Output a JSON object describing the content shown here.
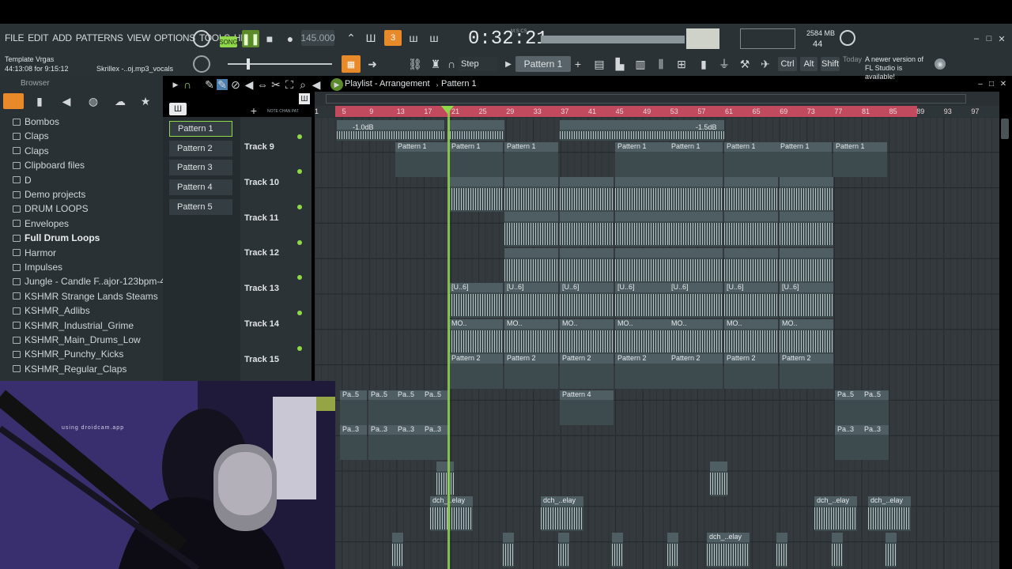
{
  "menu": [
    "FILE",
    "EDIT",
    "ADD",
    "PATTERNS",
    "VIEW",
    "OPTIONS",
    "TOOLS",
    "HELP"
  ],
  "transport": {
    "mode": "SONG",
    "tempo": "145.000",
    "time": "0:32:21",
    "time_unit": "M:S:CS",
    "memory": "2584 MB",
    "cpu": "44"
  },
  "hint": {
    "title": "Template Vrgas",
    "line2": "44:13:08 for 9:15:12",
    "file": "Skrillex -..oj.mp3_vocals"
  },
  "toolbar": {
    "snap": "Step",
    "pattern": "Pattern 1",
    "keys": [
      "Ctrl",
      "Alt",
      "Shift"
    ],
    "news_prefix": "Today",
    "news": "A newer version of FL Studio is available!"
  },
  "browser": {
    "title": "Browser",
    "items": [
      "Bombos",
      "Claps",
      "Claps",
      "Clipboard files",
      "D",
      "Demo projects",
      "DRUM LOOPS",
      "Envelopes",
      "Full Drum Loops",
      "Harmor",
      "Impulses",
      "Jungle - Candle F..ajor-123bpm-451hz",
      "KSHMR Strange Lands Steams",
      "KSHMR_Adlibs",
      "KSHMR_Industrial_Grime",
      "KSHMR_Main_Drums_Low",
      "KSHMR_Punchy_Kicks",
      "KSHMR_Regular_Claps"
    ]
  },
  "playlist": {
    "title": "Playlist - Arrangement",
    "pattern": "Pattern 1"
  },
  "patterns": [
    "Pattern 1",
    "Pattern 2",
    "Pattern 3",
    "Pattern 4",
    "Pattern 5"
  ],
  "tracks": [
    "Track 9",
    "Track 10",
    "Track 11",
    "Track 12",
    "Track 13",
    "Track 14",
    "Track 15"
  ],
  "ruler": [
    "1",
    "5",
    "9",
    "13",
    "17",
    "21",
    "25",
    "29",
    "33",
    "37",
    "41",
    "45",
    "49",
    "53",
    "57",
    "61",
    "65",
    "69",
    "73",
    "77",
    "81",
    "85",
    "89",
    "93",
    "97"
  ],
  "clips": {
    "vol1": "-1.0dB",
    "vol2": "-1.5dB",
    "p1": "Pattern 1",
    "p2": "Pattern 2",
    "p4": "Pattern 4",
    "pa5": "Pa..5",
    "pa3": "Pa..3",
    "u6": "[U..6]",
    "mo": "MO..",
    "dch": "dch_..elay"
  },
  "webcam": {
    "caption": "using droidcam.app"
  }
}
